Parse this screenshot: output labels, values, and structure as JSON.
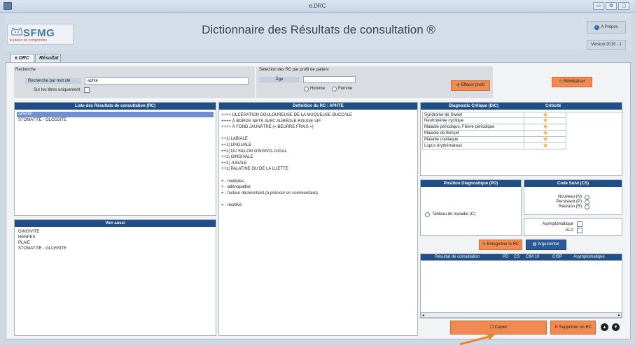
{
  "window": {
    "title": "e.DRC",
    "controls": [
      "▭",
      "⧉",
      "▢"
    ]
  },
  "header": {
    "logo": {
      "brand": "SFMG",
      "tagline": "le plaisir de comprendre"
    },
    "title": "Dictionnaire des Résultats de consultation ®",
    "about_label": "A Propos",
    "version_label": "Version 2015 - 1"
  },
  "tabs": [
    {
      "label": "e.DRC",
      "active": true
    },
    {
      "label": "Résultat",
      "active": false
    }
  ],
  "search": {
    "section_label": "Recherche",
    "keyword_label": "Recherche par mot clé",
    "keyword_value": "aphte",
    "titles_only_label": "Sur les titres uniquement"
  },
  "profile": {
    "section_label": "Sélection des RC par profil de patient",
    "age_label": "Âge",
    "age_value": "",
    "sex_options": [
      "Homme",
      "Femme"
    ],
    "clear_profile_label": "Effacer profil",
    "reset_label": "Réinitialiser"
  },
  "rc_list": {
    "title": "Liste des Résultats de consultation (RC)",
    "items": [
      {
        "label": "APHTE",
        "selected": true
      },
      {
        "label": "STOMATITE - GLOSSITE",
        "selected": false
      }
    ]
  },
  "see_also": {
    "title": "Voir aussi",
    "items": [
      "GINGIVITE",
      "HERPES",
      "PLAIE",
      "STOMATITE - GLOSSITE"
    ]
  },
  "definition": {
    "title": "Définition du RC : APHTE",
    "lines": [
      "++++ ULCÉRATION DOULOUREUSE DE LA MUQUEUSE BUCCALE",
      "++++ À BORDS NETS AVEC AURÉOLE ROUGE VIF",
      "++++ À FOND JAUNÂTRE (« BEURRE FRAIS »)",
      "",
      "++1| LABIALE",
      "++1| LINGUALE",
      "++1| DU SILLON GINGIVO-JUGAL",
      "++1| GINGIVALE",
      "++1| JUGALE",
      "++1| PALATINE OU DE LA LUETTE",
      "",
      "+ - multiples",
      "+ - adénopathie",
      "+ - facteur déclenchant (à préciser en commentaire)",
      "",
      "+ - récidive"
    ]
  },
  "critical_diagnosis": {
    "title": "Diagnostic Critique (DiC)",
    "criticality_label": "Criticité",
    "rows": [
      {
        "name": "Syndrome de Sweet",
        "stars": 1
      },
      {
        "name": "Neutropénie cyclique",
        "stars": 1
      },
      {
        "name": "Maladie périodique, Fièvre périodique",
        "stars": 1
      },
      {
        "name": "Maladie de Behçet",
        "stars": 1
      },
      {
        "name": "Maladie coeliaque",
        "stars": 1
      },
      {
        "name": "Lupus érythémateux",
        "stars": 1
      }
    ]
  },
  "diagnostic_position": {
    "title": "Position Diagnostique (PD)",
    "option": "Tableau de maladie (C)"
  },
  "follow_code": {
    "title": "Code Suivi (CS)",
    "options": [
      "Nouveau (N)",
      "Persistant (P)",
      "Révision (R)"
    ],
    "checks": [
      "Asymptomatique",
      "ALD"
    ]
  },
  "actions": {
    "save_label": "Enregistrer le RC",
    "argue_label": "Argumenter",
    "copy_label": "Copier",
    "delete_label": "Supprimer un RC"
  },
  "results_table": {
    "columns": [
      "Résultat de consultation",
      "PD",
      "CS",
      "CIM 10",
      "CISP",
      "Asymptomatique"
    ]
  }
}
